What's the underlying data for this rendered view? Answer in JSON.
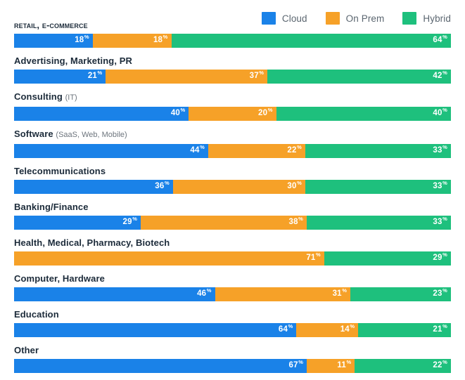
{
  "legend": {
    "position": "top-right",
    "items": [
      {
        "label": "Cloud",
        "color": "#1a82e8",
        "key": "cloud"
      },
      {
        "label": "On Prem",
        "color": "#f6a128",
        "key": "on_prem"
      },
      {
        "label": "Hybrid",
        "color": "#1ec07d",
        "key": "hybrid"
      }
    ]
  },
  "colors": {
    "cloud": "#1a82e8",
    "on_prem": "#f6a128",
    "hybrid": "#1ec07d",
    "label_text": "#1c2b3a",
    "sub_label_text": "#6d757d",
    "legend_text": "#5b6670",
    "value_text": "#ffffff",
    "background": "#ffffff"
  },
  "chart_data": {
    "type": "bar",
    "orientation": "horizontal",
    "stacked": true,
    "normalized_percent": true,
    "title": "",
    "subtitle": "",
    "xlabel": "",
    "ylabel": "",
    "xlim": [
      0,
      100
    ],
    "grid": false,
    "legend_position": "top-right",
    "value_suffix": "%",
    "categories": [
      "Retail, E-commerce",
      "Advertising, Marketing, PR",
      "Consulting (IT)",
      "Software (SaaS, Web, Mobile)",
      "Telecommunications",
      "Banking/Finance",
      "Health, Medical, Pharmacy, Biotech",
      "Computer, Hardware",
      "Education",
      "Other"
    ],
    "series": [
      {
        "name": "Cloud",
        "color": "#1a82e8",
        "values": [
          18,
          21,
          40,
          44,
          36,
          29,
          0,
          46,
          64,
          67
        ]
      },
      {
        "name": "On Prem",
        "color": "#f6a128",
        "values": [
          18,
          37,
          20,
          22,
          30,
          38,
          71,
          31,
          14,
          11
        ]
      },
      {
        "name": "Hybrid",
        "color": "#1ec07d",
        "values": [
          64,
          42,
          40,
          33,
          33,
          33,
          29,
          23,
          21,
          22
        ]
      }
    ]
  },
  "rows": [
    {
      "label_main": "Retail, E-commerce",
      "label_style": "smallcaps",
      "label_sub": "",
      "segments": [
        {
          "key": "cloud",
          "value": 18,
          "label": "18",
          "suffix": "%",
          "color": "#1a82e8"
        },
        {
          "key": "on_prem",
          "value": 18,
          "label": "18",
          "suffix": "%",
          "color": "#f6a128"
        },
        {
          "key": "hybrid",
          "value": 64,
          "label": "64",
          "suffix": "%",
          "color": "#1ec07d"
        }
      ]
    },
    {
      "label_main": "Advertising, Marketing, PR",
      "label_style": "normal",
      "label_sub": "",
      "segments": [
        {
          "key": "cloud",
          "value": 21,
          "label": "21",
          "suffix": "%",
          "color": "#1a82e8"
        },
        {
          "key": "on_prem",
          "value": 37,
          "label": "37",
          "suffix": "%",
          "color": "#f6a128"
        },
        {
          "key": "hybrid",
          "value": 42,
          "label": "42",
          "suffix": "%",
          "color": "#1ec07d"
        }
      ]
    },
    {
      "label_main": "Consulting",
      "label_style": "normal",
      "label_sub": "(IT)",
      "segments": [
        {
          "key": "cloud",
          "value": 40,
          "label": "40",
          "suffix": "%",
          "color": "#1a82e8"
        },
        {
          "key": "on_prem",
          "value": 20,
          "label": "20",
          "suffix": "%",
          "color": "#f6a128"
        },
        {
          "key": "hybrid",
          "value": 40,
          "label": "40",
          "suffix": "%",
          "color": "#1ec07d"
        }
      ]
    },
    {
      "label_main": "Software",
      "label_style": "normal",
      "label_sub": "(SaaS, Web, Mobile)",
      "segments": [
        {
          "key": "cloud",
          "value": 44,
          "label": "44",
          "suffix": "%",
          "color": "#1a82e8"
        },
        {
          "key": "on_prem",
          "value": 22,
          "label": "22",
          "suffix": "%",
          "color": "#f6a128"
        },
        {
          "key": "hybrid",
          "value": 33,
          "label": "33",
          "suffix": "%",
          "color": "#1ec07d"
        }
      ]
    },
    {
      "label_main": "Telecommunications",
      "label_style": "normal",
      "label_sub": "",
      "segments": [
        {
          "key": "cloud",
          "value": 36,
          "label": "36",
          "suffix": "%",
          "color": "#1a82e8"
        },
        {
          "key": "on_prem",
          "value": 30,
          "label": "30",
          "suffix": "%",
          "color": "#f6a128"
        },
        {
          "key": "hybrid",
          "value": 33,
          "label": "33",
          "suffix": "%",
          "color": "#1ec07d"
        }
      ]
    },
    {
      "label_main": "Banking/Finance",
      "label_style": "normal",
      "label_sub": "",
      "segments": [
        {
          "key": "cloud",
          "value": 29,
          "label": "29",
          "suffix": "%",
          "color": "#1a82e8"
        },
        {
          "key": "on_prem",
          "value": 38,
          "label": "38",
          "suffix": "%",
          "color": "#f6a128"
        },
        {
          "key": "hybrid",
          "value": 33,
          "label": "33",
          "suffix": "%",
          "color": "#1ec07d"
        }
      ]
    },
    {
      "label_main": "Health, Medical, Pharmacy, Biotech",
      "label_style": "normal",
      "label_sub": "",
      "segments": [
        {
          "key": "cloud",
          "value": 0,
          "label": "",
          "suffix": "",
          "color": "#1a82e8"
        },
        {
          "key": "on_prem",
          "value": 71,
          "label": "71",
          "suffix": "%",
          "color": "#f6a128"
        },
        {
          "key": "hybrid",
          "value": 29,
          "label": "29",
          "suffix": "%",
          "color": "#1ec07d"
        }
      ]
    },
    {
      "label_main": "Computer, Hardware",
      "label_style": "normal",
      "label_sub": "",
      "segments": [
        {
          "key": "cloud",
          "value": 46,
          "label": "46",
          "suffix": "%",
          "color": "#1a82e8"
        },
        {
          "key": "on_prem",
          "value": 31,
          "label": "31",
          "suffix": "%",
          "color": "#f6a128"
        },
        {
          "key": "hybrid",
          "value": 23,
          "label": "23",
          "suffix": "%",
          "color": "#1ec07d"
        }
      ]
    },
    {
      "label_main": "Education",
      "label_style": "normal",
      "label_sub": "",
      "segments": [
        {
          "key": "cloud",
          "value": 64,
          "label": "64",
          "suffix": "%",
          "color": "#1a82e8"
        },
        {
          "key": "on_prem",
          "value": 14,
          "label": "14",
          "suffix": "%",
          "color": "#f6a128"
        },
        {
          "key": "hybrid",
          "value": 21,
          "label": "21",
          "suffix": "%",
          "color": "#1ec07d"
        }
      ]
    },
    {
      "label_main": "Other",
      "label_style": "normal",
      "label_sub": "",
      "segments": [
        {
          "key": "cloud",
          "value": 67,
          "label": "67",
          "suffix": "%",
          "color": "#1a82e8"
        },
        {
          "key": "on_prem",
          "value": 11,
          "label": "11",
          "suffix": "%",
          "color": "#f6a128"
        },
        {
          "key": "hybrid",
          "value": 22,
          "label": "22",
          "suffix": "%",
          "color": "#1ec07d"
        }
      ]
    }
  ]
}
